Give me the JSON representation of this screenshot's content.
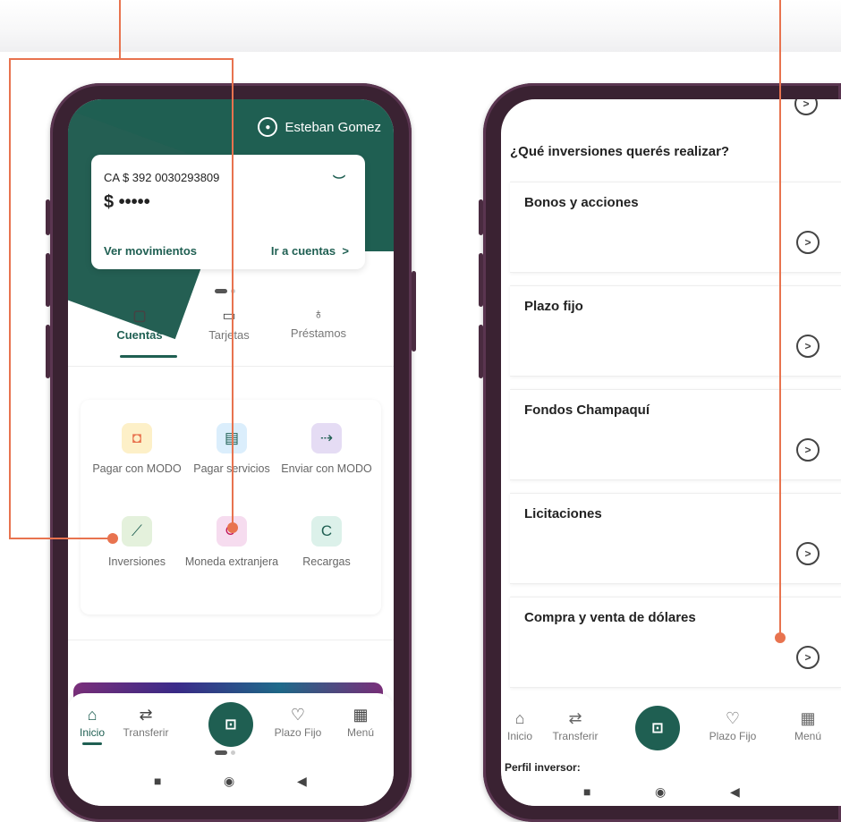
{
  "left_screen": {
    "user_name": "Esteban Gomez",
    "account": {
      "number": "CA $ 392 0030293809",
      "balance_masked": "$ •••••",
      "link_movements": "Ver movimientos",
      "link_accounts": "Ir a cuentas"
    },
    "tabs": [
      {
        "label": "Cuentas",
        "icon": "wallet-icon"
      },
      {
        "label": "Tarjetas",
        "icon": "card-icon"
      },
      {
        "label": "Préstamos",
        "icon": "money-bag-icon"
      }
    ],
    "services": [
      {
        "label": "Pagar con MODO",
        "icon": "bag-icon",
        "color": "#fdf0c8"
      },
      {
        "label": "Pagar servicios",
        "icon": "receipt-icon",
        "color": "#dbeefc"
      },
      {
        "label": "Enviar con MODO",
        "icon": "send-icon",
        "color": "#e5dcf4"
      },
      {
        "label": "Inversiones",
        "icon": "chart-icon",
        "color": "#e4f1dc"
      },
      {
        "label": "Moneda extranjera",
        "icon": "exchange-icon",
        "color": "#f6dcef"
      },
      {
        "label": "Recargas",
        "icon": "refresh-icon",
        "color": "#dcf1ea"
      }
    ],
    "nav": [
      {
        "label": "Inicio",
        "icon": "home-icon"
      },
      {
        "label": "Transferir",
        "icon": "transfer-icon"
      },
      {
        "label": "Plazo Fijo",
        "icon": "piggy-bank-icon"
      },
      {
        "label": "Menú",
        "icon": "grid-icon"
      }
    ]
  },
  "right_screen": {
    "question": "¿Qué inversiones querés realizar?",
    "options": [
      {
        "label": "Bonos y acciones"
      },
      {
        "label": "Plazo fijo"
      },
      {
        "label": "Fondos Champaquí"
      },
      {
        "label": "Licitaciones"
      },
      {
        "label": "Compra y venta de dólares"
      }
    ],
    "nav": [
      {
        "label": "Inicio",
        "icon": "home-icon"
      },
      {
        "label": "Transferir",
        "icon": "transfer-icon"
      },
      {
        "label": "Plazo Fijo",
        "icon": "piggy-bank-icon"
      },
      {
        "label": "Menú",
        "icon": "grid-icon"
      }
    ],
    "footer_label": "Perfil inversor:"
  },
  "colors": {
    "brand_green": "#1f5f52",
    "callout": "#e8734f",
    "phone_frame": "#3a2232"
  }
}
